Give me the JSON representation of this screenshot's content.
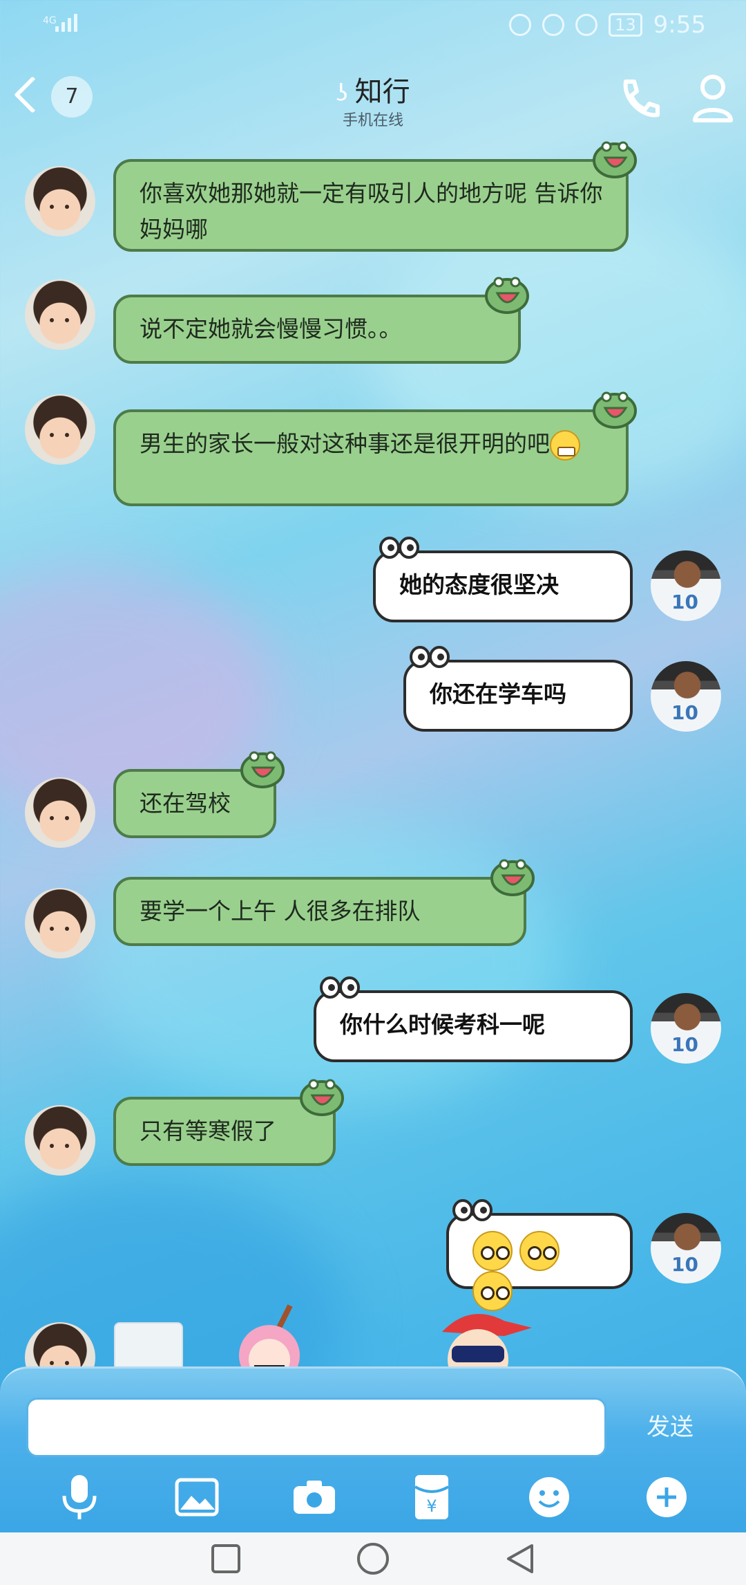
{
  "status_bar": {
    "network": "4G",
    "battery": "13",
    "time": "9:55"
  },
  "header": {
    "unread_count": "7",
    "contact_name": "知行",
    "presence": "手机在线"
  },
  "messages": [
    {
      "side": "in",
      "text": "你喜欢她那她就一定有吸引人的地方呢 告诉你妈妈哪"
    },
    {
      "side": "in",
      "text": "说不定她就会慢慢习惯。。"
    },
    {
      "side": "in",
      "text": "男生的家长一般对这种事还是很开明的吧",
      "emoji": "grimacing-emoji"
    },
    {
      "side": "out",
      "text": "她的态度很坚决"
    },
    {
      "side": "out",
      "text": "你还在学车吗"
    },
    {
      "side": "in",
      "text": "还在驾校"
    },
    {
      "side": "in",
      "text": "要学一个上午 人很多在排队"
    },
    {
      "side": "out",
      "text": "你什么时候考科一呢"
    },
    {
      "side": "in",
      "text": "只有等寒假了"
    },
    {
      "side": "out",
      "text": "",
      "emoji": "wide-eyes-emoji-x3"
    }
  ],
  "input": {
    "placeholder": "",
    "value": ""
  },
  "send_button": {
    "label": "发送"
  },
  "toolbar": [
    "microphone-icon",
    "image-icon",
    "camera-icon",
    "red-packet-icon",
    "emoji-icon",
    "plus-icon"
  ],
  "colors": {
    "incoming_bubble": "#9ad08e",
    "outgoing_bubble": "#ffffff",
    "panel": "#3ba6e6",
    "send_text": "#ecf8ff"
  }
}
